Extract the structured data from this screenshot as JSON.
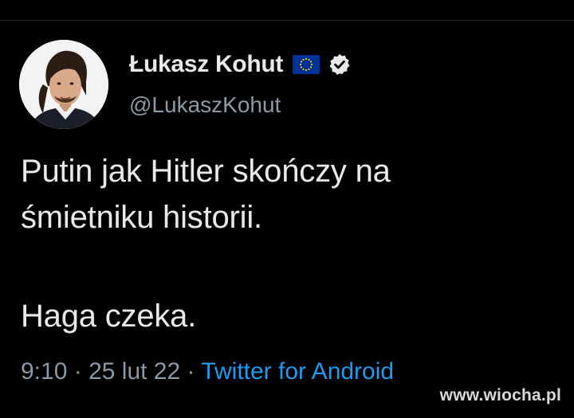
{
  "tweet": {
    "display_name": "Łukasz Kohut",
    "handle": "@LukaszKohut",
    "flag_icon": "eu-flag-icon",
    "verified_icon": "verified-badge-icon",
    "text_paragraph_1": "Putin jak Hitler skończy na\nśmietniku historii.",
    "text_paragraph_2": "Haga czeka.",
    "time": "9:10",
    "separator": "·",
    "date": "25 lut 22",
    "source": "Twitter for Android"
  },
  "watermark": {
    "text": "www.wiocha.pl"
  },
  "colors": {
    "background": "#000000",
    "primary_text": "#e7e9ea",
    "secondary_text": "#8b98a5",
    "link": "#1d9bf0",
    "eu_blue": "#003399",
    "eu_star": "#ffcc00"
  }
}
